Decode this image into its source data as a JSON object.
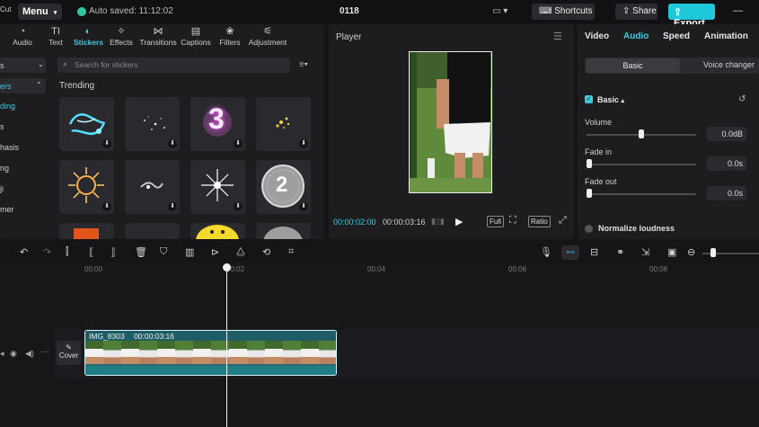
{
  "topbar": {
    "app_name_fragment": "Cut",
    "menu_label": "Menu",
    "autosave_text": "Auto saved: 11:12:02",
    "project_title": "0118",
    "shortcuts_label": "Shortcuts",
    "share_label": "Share",
    "export_label": "Export"
  },
  "media_tabs": [
    {
      "label": "Audio",
      "icon": "music-note-icon"
    },
    {
      "label": "Text",
      "icon": "text-icon"
    },
    {
      "label": "Stickers",
      "icon": "sticker-icon",
      "active": true
    },
    {
      "label": "Effects",
      "icon": "sparkle-icon"
    },
    {
      "label": "Transitions",
      "icon": "transition-icon"
    },
    {
      "label": "Captions",
      "icon": "captions-icon"
    },
    {
      "label": "Filters",
      "icon": "filter-icon"
    },
    {
      "label": "Adjustment",
      "icon": "adjustment-icon"
    }
  ],
  "sidebar": {
    "items": [
      "s",
      "ers",
      "ding",
      "s",
      "hasis",
      "ng",
      "ji",
      "mer"
    ]
  },
  "stickers": {
    "search_placeholder": "Search for stickers",
    "section_title": "Trending",
    "badge_3": "3",
    "badge_2": "2"
  },
  "player": {
    "title": "Player",
    "current_time": "00:00:02:00",
    "total_time": "00:00:03:16",
    "full_label": "Full",
    "ratio_label": "Ratio"
  },
  "inspector": {
    "tabs": [
      "Video",
      "Audio",
      "Speed",
      "Animation"
    ],
    "active_tab": "Audio",
    "segments": [
      "Basic",
      "Voice changer"
    ],
    "section_title": "Basic",
    "volume_label": "Volume",
    "volume_value": "0.0dB",
    "fade_in_label": "Fade in",
    "fade_in_value": "0.0s",
    "fade_out_label": "Fade out",
    "fade_out_value": "0.0s",
    "normalize_label": "Normalize loudness",
    "volume_level": 0.5,
    "fade_in_level": 0.0,
    "fade_out_level": 0.0
  },
  "timeline": {
    "ruler_labels": [
      "00:00",
      "00:02",
      "00:04",
      "00:06",
      "00:08"
    ],
    "clip_name": "IMG_8303",
    "clip_duration": "00:00:03:16",
    "cover_label": "Cover"
  },
  "colors": {
    "accent": "#3cc9dc",
    "export": "#1fc8d8",
    "autosave": "#36c3a3"
  }
}
